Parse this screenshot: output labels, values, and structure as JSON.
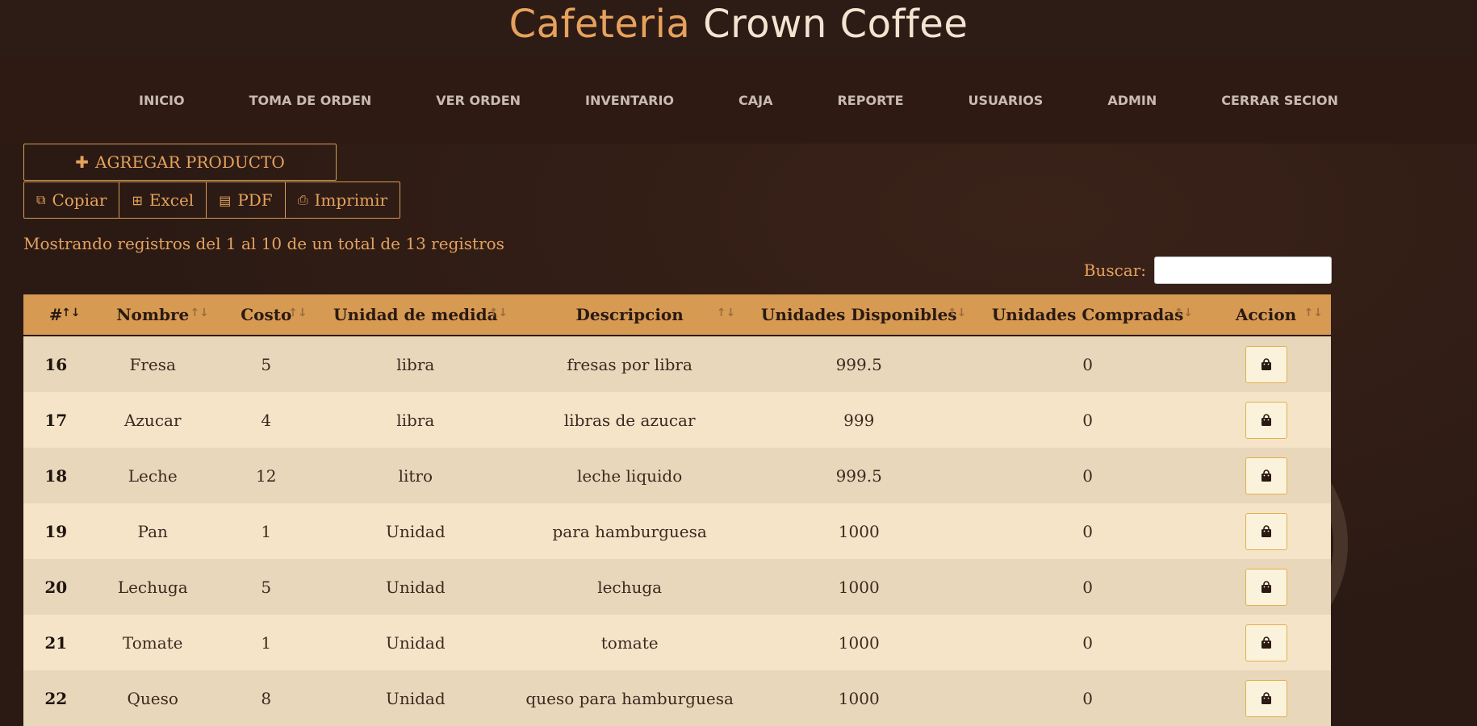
{
  "brand": {
    "accent": "Cafeteria",
    "rest": " Crown Coffee"
  },
  "nav": [
    "INICIO",
    "TOMA DE ORDEN",
    "VER ORDEN",
    "INVENTARIO",
    "CAJA",
    "REPORTE",
    "USUARIOS",
    "ADMIN",
    "CERRAR SECION"
  ],
  "toolbar": {
    "add_label": "AGREGAR PRODUCTO",
    "copy_label": "Copiar",
    "excel_label": "Excel",
    "pdf_label": "PDF",
    "print_label": "Imprimir"
  },
  "info": "Mostrando registros del 1 al 10 de un total de 13 registros",
  "search": {
    "label": "Buscar:",
    "value": ""
  },
  "table": {
    "headers": [
      "#",
      "Nombre",
      "Costo",
      "Unidad de medida",
      "Descripcion",
      "Unidades Disponibles",
      "Unidades Compradas",
      "Accion"
    ],
    "rows": [
      {
        "id": "16",
        "nombre": "Fresa",
        "costo": "5",
        "unidad": "libra",
        "desc": "fresas por libra",
        "disp": "999.5",
        "comp": "0"
      },
      {
        "id": "17",
        "nombre": "Azucar",
        "costo": "4",
        "unidad": "libra",
        "desc": "libras de azucar",
        "disp": "999",
        "comp": "0"
      },
      {
        "id": "18",
        "nombre": "Leche",
        "costo": "12",
        "unidad": "litro",
        "desc": "leche liquido",
        "disp": "999.5",
        "comp": "0"
      },
      {
        "id": "19",
        "nombre": "Pan",
        "costo": "1",
        "unidad": "Unidad",
        "desc": "para hamburguesa",
        "disp": "1000",
        "comp": "0"
      },
      {
        "id": "20",
        "nombre": "Lechuga",
        "costo": "5",
        "unidad": "Unidad",
        "desc": "lechuga",
        "disp": "1000",
        "comp": "0"
      },
      {
        "id": "21",
        "nombre": "Tomate",
        "costo": "1",
        "unidad": "Unidad",
        "desc": "tomate",
        "disp": "1000",
        "comp": "0"
      },
      {
        "id": "22",
        "nombre": "Queso",
        "costo": "8",
        "unidad": "Unidad",
        "desc": "queso para hamburguesa",
        "disp": "1000",
        "comp": "0"
      }
    ]
  },
  "colors": {
    "accent": "#e6a25d",
    "header_bg": "#d69a53",
    "bg": "#2b1a14"
  }
}
